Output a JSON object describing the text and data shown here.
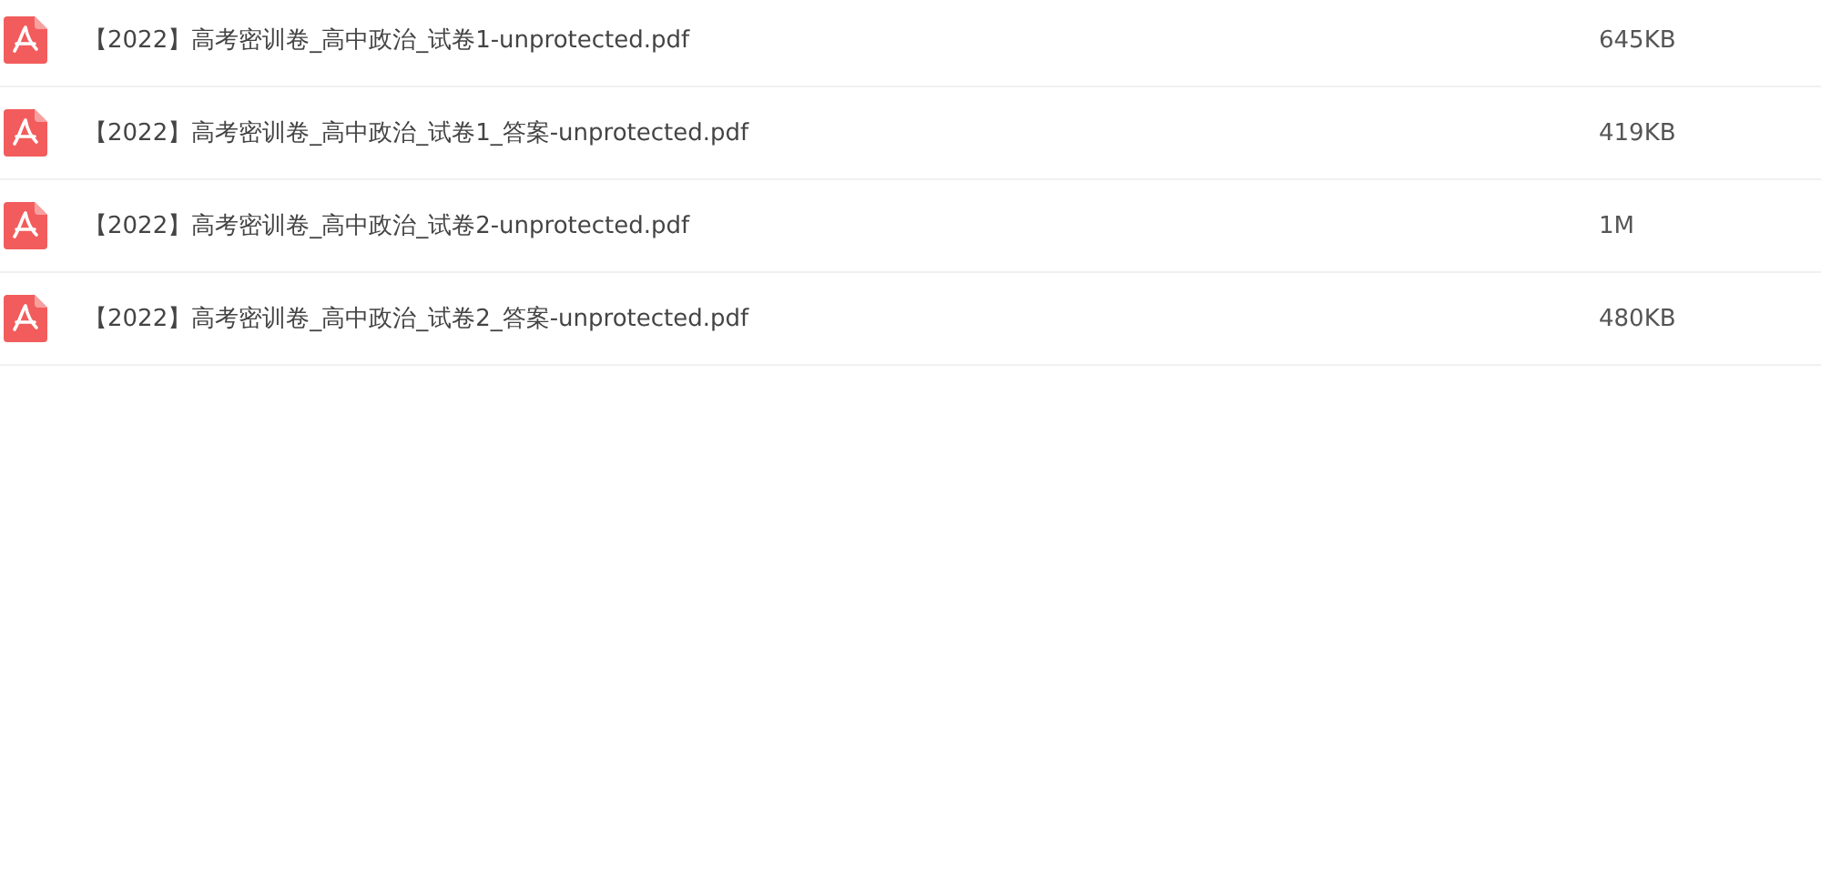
{
  "files": [
    {
      "kind": "pdf",
      "name": "【2022】高考密训卷_高中政治_试卷1-unprotected.pdf",
      "size": "645KB"
    },
    {
      "kind": "pdf",
      "name": "【2022】高考密训卷_高中政治_试卷1_答案-unprotected.pdf",
      "size": "419KB"
    },
    {
      "kind": "pdf",
      "name": "【2022】高考密训卷_高中政治_试卷2-unprotected.pdf",
      "size": "1M"
    },
    {
      "kind": "pdf",
      "name": "【2022】高考密训卷_高中政治_试卷2_答案-unprotected.pdf",
      "size": "480KB"
    }
  ]
}
